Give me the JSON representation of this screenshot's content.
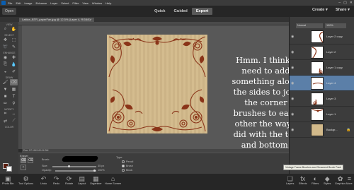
{
  "menu": {
    "items": [
      "File",
      "Edit",
      "Image",
      "Enhance",
      "Layer",
      "Select",
      "Filter",
      "View",
      "Window",
      "Help"
    ],
    "window_controls": [
      "–",
      "▢",
      "✕"
    ]
  },
  "modebar": {
    "open_label": "Open",
    "modes": [
      "Quick",
      "Guided",
      "Expert"
    ],
    "active_mode": "Expert",
    "create_label": "Create",
    "share_label": "Share"
  },
  "document": {
    "tab_label": "Lattice_BTR_paperFan.jpg @ 12.5% (Layer 4, RGB/8)*",
    "status": "Doc: 57.1M/143.04.3M"
  },
  "toolbox": {
    "sections": [
      "VIEW",
      "SELECT",
      "ENHANCE",
      "DRAW",
      "MODIFY",
      "COLOR"
    ]
  },
  "canvas": {
    "caption": "Hmm. I think I need to add something along the sides to join the corner brushes to each other the way I did with the top and bottom."
  },
  "options": {
    "title": "Eraser",
    "brush_label": "Brush:",
    "size_label": "Size:",
    "size_value": "35 px",
    "opacity_label": "Opacity:",
    "opacity_value": "100%",
    "type_label": "Type:",
    "type_options": [
      "Pencil",
      "Brush",
      "Block"
    ]
  },
  "taskbar": {
    "left": [
      "Photo Bin",
      "Tool Options",
      "Undo",
      "Redo",
      "Rotate",
      "Layout",
      "Organizer",
      "Home Screen"
    ],
    "right": [
      "Layers",
      "Effects",
      "Filters",
      "Styles",
      "Graphics",
      "More"
    ]
  },
  "layers_panel": {
    "blend_mode": "Normal",
    "opacity": "100%",
    "layers": [
      {
        "name": "Layer 2 copy"
      },
      {
        "name": "Layer 2"
      },
      {
        "name": "Layer 1 copy"
      },
      {
        "name": "Layer 4",
        "selected": true
      },
      {
        "name": "Layer 3"
      },
      {
        "name": "Layer 1"
      },
      {
        "name": "Backgr..."
      }
    ],
    "tooltip": "Vintage Frame Brushes and Ornament Brush Pack"
  },
  "colors": {
    "foreground": "#5a1e10",
    "ornament": "#8a3418",
    "paper": "#d2b98a",
    "canvas_bg": "#585858",
    "selected_layer": "#5b7fa8"
  }
}
